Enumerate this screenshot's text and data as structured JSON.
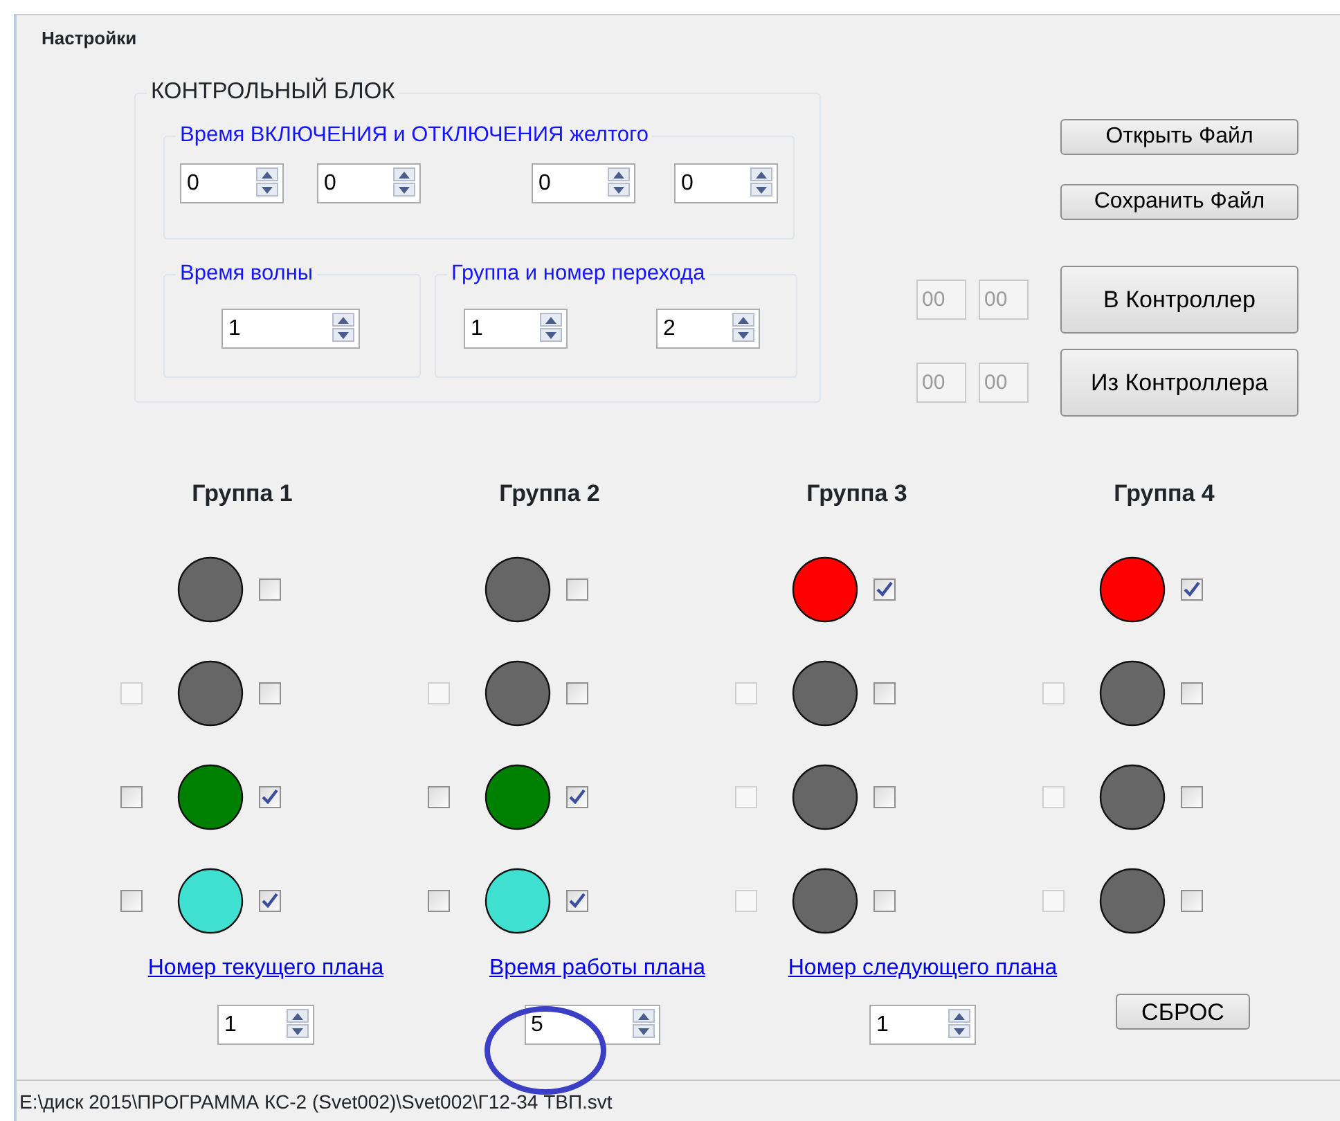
{
  "window": {
    "title": "Настройки"
  },
  "control_block": {
    "title": "КОНТРОЛЬНЫЙ БЛОК",
    "yellow_time": {
      "title": "Время ВКЛЮЧЕНИЯ и ОТКЛЮЧЕНИЯ желтого",
      "values": [
        "0",
        "0",
        "0",
        "0"
      ]
    },
    "wave_time": {
      "title": "Время волны",
      "value": "1"
    },
    "crossing": {
      "title": "Группа и номер перехода",
      "values": [
        "1",
        "2"
      ]
    }
  },
  "file_buttons": [
    "Открыть Файл",
    "Сохранить Файл"
  ],
  "controller_rows": [
    {
      "fields": [
        "00",
        "00"
      ],
      "button": "В Контроллер"
    },
    {
      "fields": [
        "00",
        "00"
      ],
      "button": "Из Контроллера"
    }
  ],
  "groups": [
    {
      "title": "Группа 1",
      "lights": [
        {
          "color": "#666666",
          "checked": false
        },
        {
          "color": "#666666",
          "left": {
            "checked": false,
            "disabled": true
          },
          "checked": false
        },
        {
          "color": "#008000",
          "left": {
            "checked": false,
            "disabled": false
          },
          "checked": true
        },
        {
          "color": "#40e0d0",
          "left": {
            "checked": false,
            "disabled": false
          },
          "checked": true
        }
      ]
    },
    {
      "title": "Группа 2",
      "lights": [
        {
          "color": "#666666",
          "checked": false
        },
        {
          "color": "#666666",
          "left": {
            "checked": false,
            "disabled": true
          },
          "checked": false
        },
        {
          "color": "#008000",
          "left": {
            "checked": false,
            "disabled": false
          },
          "checked": true
        },
        {
          "color": "#40e0d0",
          "left": {
            "checked": false,
            "disabled": false
          },
          "checked": true
        }
      ]
    },
    {
      "title": "Группа 3",
      "lights": [
        {
          "color": "#ff0000",
          "checked": true
        },
        {
          "color": "#666666",
          "left": {
            "checked": false,
            "disabled": true
          },
          "checked": false
        },
        {
          "color": "#666666",
          "left": {
            "checked": false,
            "disabled": true
          },
          "checked": false
        },
        {
          "color": "#666666",
          "left": {
            "checked": false,
            "disabled": true
          },
          "checked": false
        }
      ]
    },
    {
      "title": "Группа 4",
      "lights": [
        {
          "color": "#ff0000",
          "checked": true
        },
        {
          "color": "#666666",
          "left": {
            "checked": false,
            "disabled": true
          },
          "checked": false
        },
        {
          "color": "#666666",
          "left": {
            "checked": false,
            "disabled": true
          },
          "checked": false
        },
        {
          "color": "#666666",
          "left": {
            "checked": false,
            "disabled": true
          },
          "checked": false
        }
      ]
    }
  ],
  "plan": [
    {
      "label": "Номер текущего плана",
      "value": "1"
    },
    {
      "label": "Время работы плана",
      "value": "5"
    },
    {
      "label": "Номер следующего плана",
      "value": "1"
    }
  ],
  "reset_button": "СБРОС",
  "status_bar": "E:\\диск 2015\\ПРОГРАММА КС-2 (Svet002)\\Svet002\\Г12-34 ТВП.svt"
}
